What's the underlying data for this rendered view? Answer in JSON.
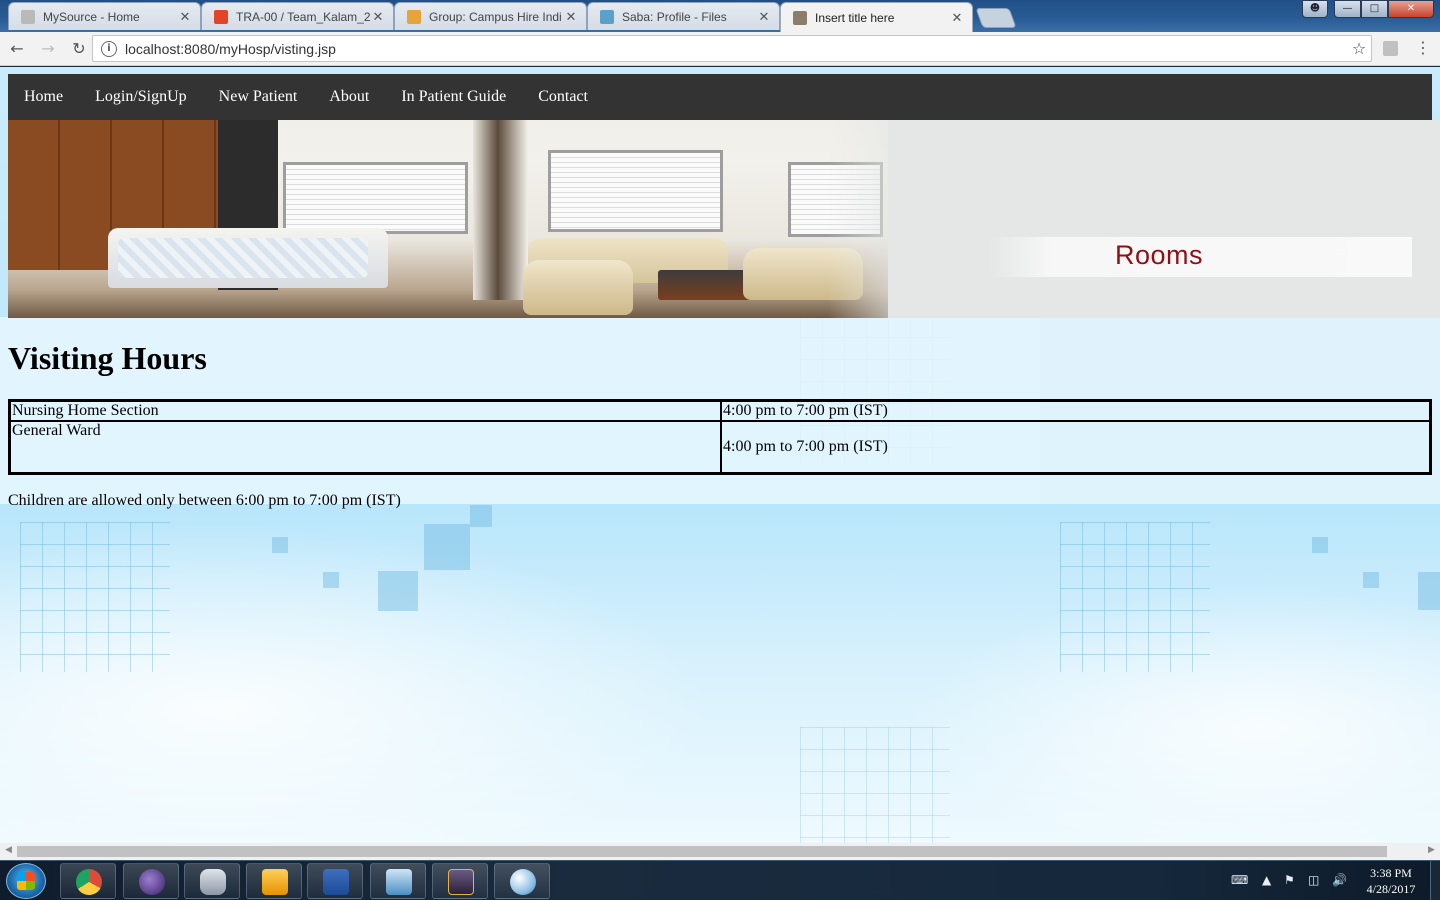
{
  "browser": {
    "tabs": [
      {
        "title": "MySource - Home",
        "favicon_color": "#b9b9b9",
        "active": false
      },
      {
        "title": "TRA-00 / Team_Kalam_2(",
        "favicon_color": "#e24329",
        "active": false
      },
      {
        "title": "Group: Campus Hire Indi",
        "favicon_color": "#e8a33a",
        "active": false
      },
      {
        "title": "Saba: Profile - Files",
        "favicon_color": "#5aa0c8",
        "active": false
      },
      {
        "title": "Insert title here",
        "favicon_color": "#8a7d6a",
        "active": true
      }
    ],
    "close_glyph": "✕",
    "url": "localhost:8080/myHosp/visting.jsp",
    "info_glyph": "i",
    "star_glyph": "☆",
    "menu_glyph": "⋮",
    "back_glyph": "←",
    "forward_glyph": "→",
    "reload_glyph": "↻"
  },
  "page": {
    "nav": [
      "Home",
      "Login/SignUp",
      "New Patient",
      "About",
      "In Patient Guide",
      "Contact"
    ],
    "banner_label": "Rooms",
    "heading": "Visiting Hours",
    "table": [
      {
        "section": "Nursing Home Section",
        "hours": "4:00 pm to 7:00 pm (IST)"
      },
      {
        "section": "General Ward",
        "hours": "4:00 pm to 7:00 pm (IST)"
      }
    ],
    "note": "Children are allowed only between 6:00 pm to 7:00 pm (IST)"
  },
  "taskbar": {
    "apps": [
      {
        "name": "chrome",
        "color": "#dd4b39"
      },
      {
        "name": "eclipse",
        "color": "#5c3d8f"
      },
      {
        "name": "database-tool",
        "color": "#9aa6b5"
      },
      {
        "name": "outlook",
        "color": "#f0a01e"
      },
      {
        "name": "word",
        "color": "#2b579a"
      },
      {
        "name": "lync",
        "color": "#4a8fc4"
      },
      {
        "name": "java-ee-ide",
        "color": "#4a3a5c"
      },
      {
        "name": "paint",
        "color": "#7fb0d8"
      }
    ],
    "time": "3:38 PM",
    "date": "4/28/2017"
  }
}
